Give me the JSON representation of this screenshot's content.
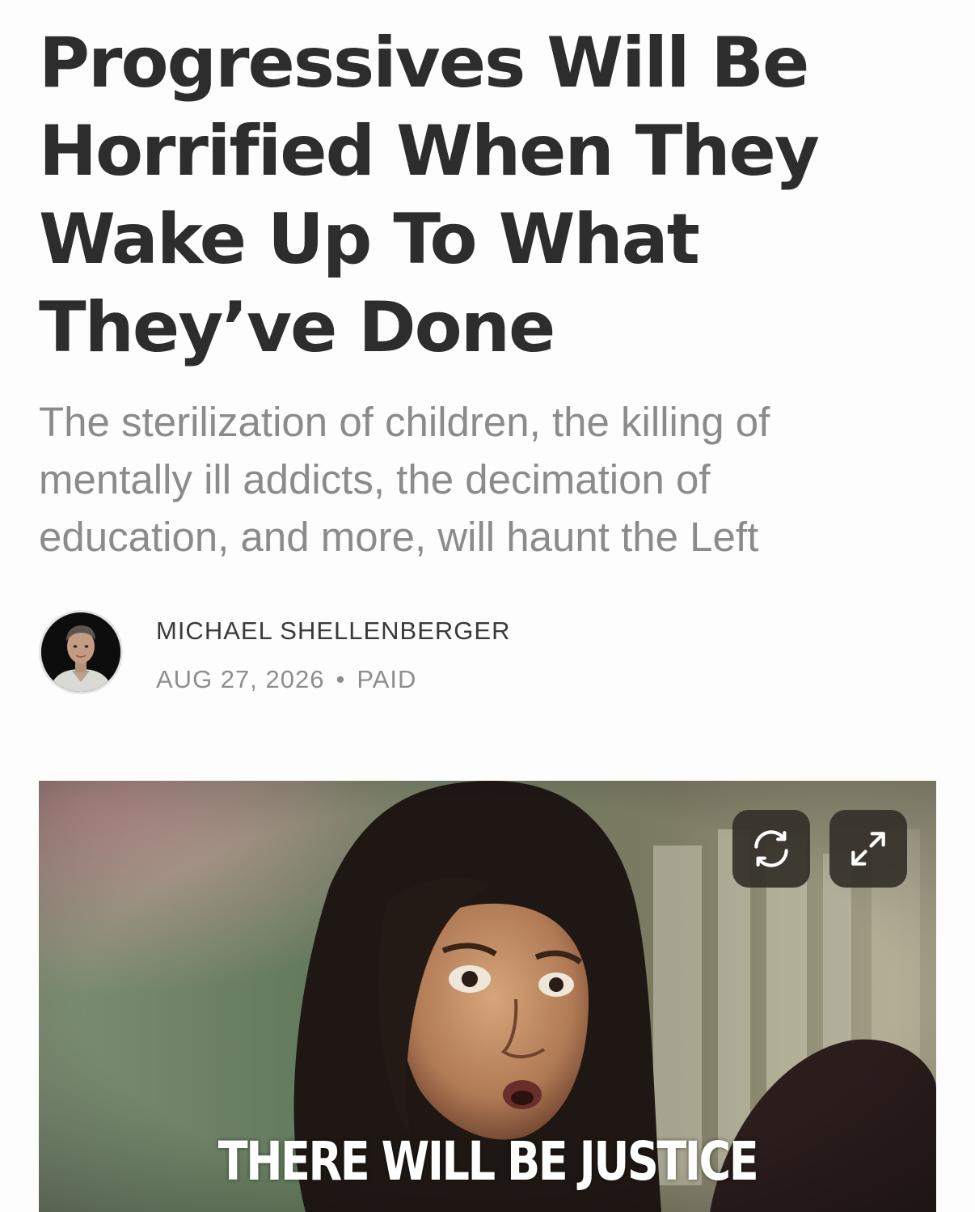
{
  "article": {
    "title": "Progressives Will Be Horrified When They Wake Up To What They’ve Done",
    "subtitle": "The sterilization of children, the killing of mentally ill addicts, the decimation of education, and more, will haunt the Left"
  },
  "byline": {
    "author": "MICHAEL SHELLENBERGER",
    "date": "AUG 27, 2026",
    "separator": "•",
    "access": "PAID"
  },
  "hero_image": {
    "caption": "THERE WILL BE JUSTICE",
    "controls": {
      "refresh_icon": "refresh-icon",
      "expand_icon": "expand-icon"
    }
  },
  "colors": {
    "title": "#2d2d2d",
    "subtitle": "#8b8b8b",
    "meta": "#8e8e8e",
    "button_bg": "#343028"
  }
}
